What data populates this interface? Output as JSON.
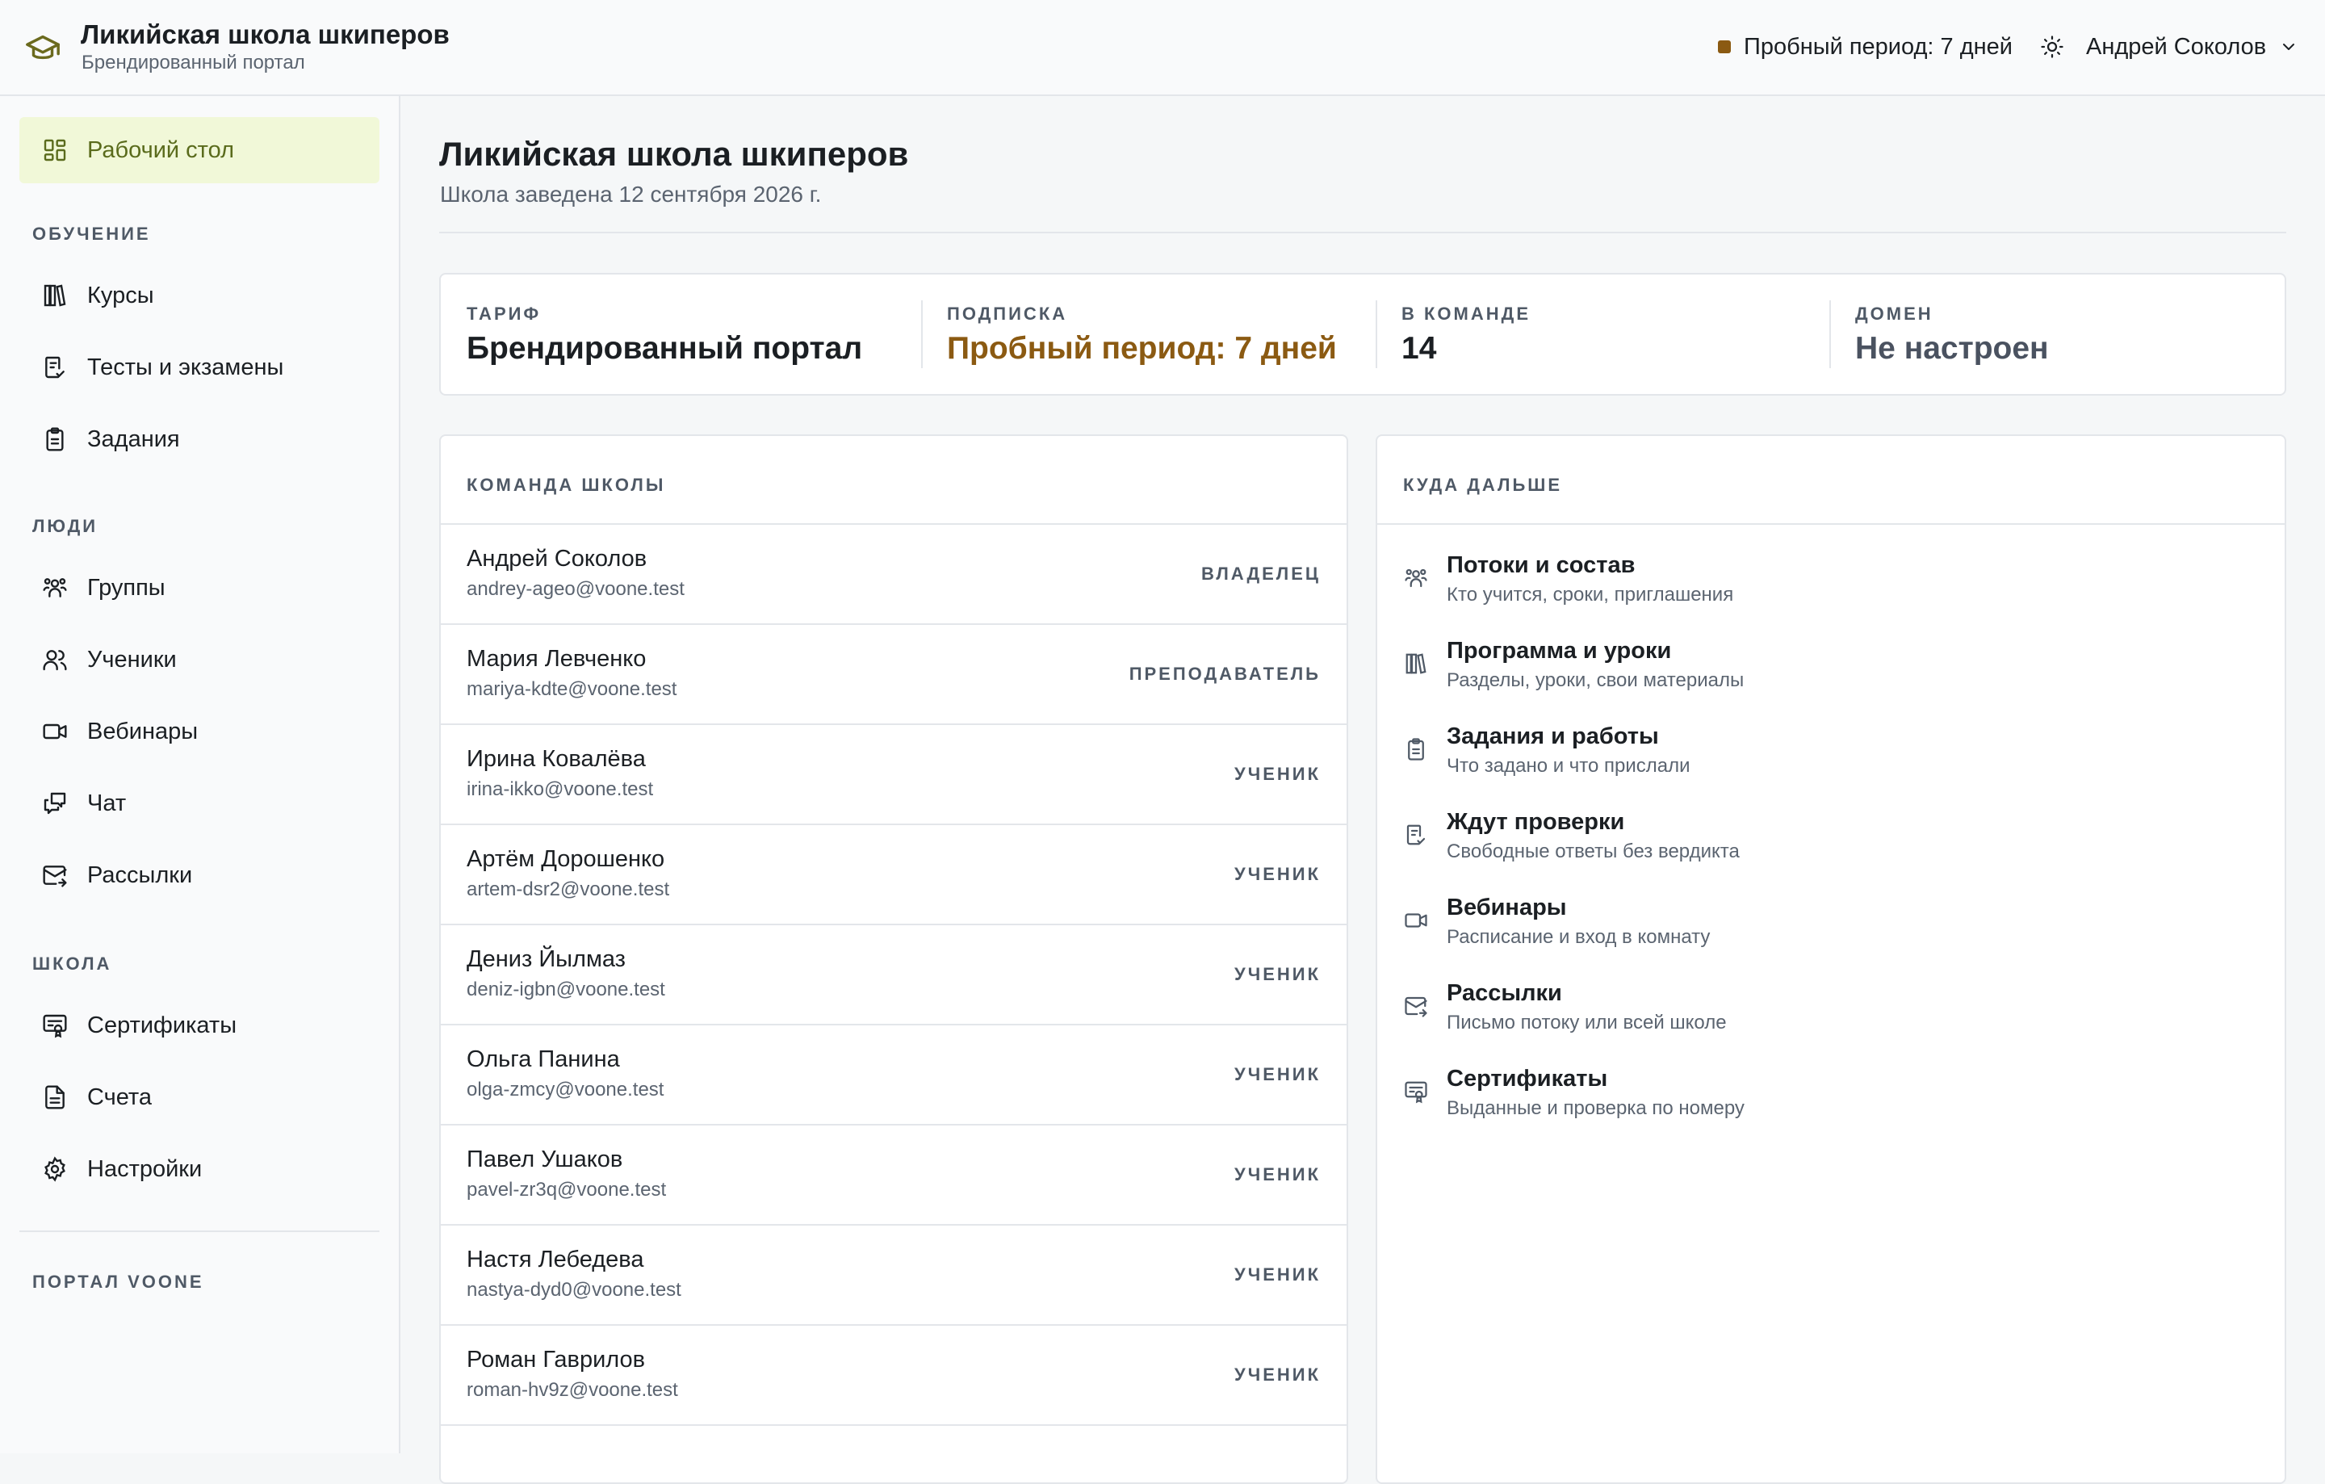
{
  "header": {
    "title": "Ликийская школа шкиперов",
    "subtitle": "Брендированный портал",
    "trial": "Пробный период: 7 дней",
    "user": "Андрей Соколов"
  },
  "sidebar": {
    "home": "Рабочий стол",
    "sections": {
      "learning": "ОБУЧЕНИЕ",
      "people": "ЛЮДИ",
      "school": "ШКОЛА",
      "portal": "ПОРТАЛ VOONE"
    },
    "learning_items": [
      "Курсы",
      "Тесты и экзамены",
      "Задания"
    ],
    "people_items": [
      "Группы",
      "Ученики",
      "Вебинары",
      "Чат",
      "Рассылки"
    ],
    "school_items": [
      "Сертификаты",
      "Счета",
      "Настройки"
    ]
  },
  "page": {
    "title": "Ликийская школа шкиперов",
    "subtitle": "Школа заведена 12 сентября 2026 г."
  },
  "stats": [
    {
      "label": "ТАРИФ",
      "value": "Брендированный портал"
    },
    {
      "label": "ПОДПИСКА",
      "value": "Пробный период: 7 дней"
    },
    {
      "label": "В КОМАНДЕ",
      "value": "14"
    },
    {
      "label": "ДОМЕН",
      "value": "Не настроен"
    }
  ],
  "team": {
    "title": "КОМАНДА ШКОЛЫ",
    "members": [
      {
        "name": "Андрей Соколов",
        "email": "andrey-ageo@voone.test",
        "role": "ВЛАДЕЛЕЦ"
      },
      {
        "name": "Мария Левченко",
        "email": "mariya-kdte@voone.test",
        "role": "ПРЕПОДАВАТЕЛЬ"
      },
      {
        "name": "Ирина Ковалёва",
        "email": "irina-ikko@voone.test",
        "role": "УЧЕНИК"
      },
      {
        "name": "Артём Дорошенко",
        "email": "artem-dsr2@voone.test",
        "role": "УЧЕНИК"
      },
      {
        "name": "Дениз Йылмаз",
        "email": "deniz-igbn@voone.test",
        "role": "УЧЕНИК"
      },
      {
        "name": "Ольга Панина",
        "email": "olga-zmcy@voone.test",
        "role": "УЧЕНИК"
      },
      {
        "name": "Павел Ушаков",
        "email": "pavel-zr3q@voone.test",
        "role": "УЧЕНИК"
      },
      {
        "name": "Настя Лебедева",
        "email": "nastya-dyd0@voone.test",
        "role": "УЧЕНИК"
      },
      {
        "name": "Роман Гаврилов",
        "email": "roman-hv9z@voone.test",
        "role": "УЧЕНИК"
      }
    ]
  },
  "next": {
    "title": "КУДА ДАЛЬШЕ",
    "items": [
      {
        "title": "Потоки и состав",
        "desc": "Кто учится, сроки, приглашения"
      },
      {
        "title": "Программа и уроки",
        "desc": "Разделы, уроки, свои материалы"
      },
      {
        "title": "Задания и работы",
        "desc": "Что задано и что прислали"
      },
      {
        "title": "Ждут проверки",
        "desc": "Свободные ответы без вердикта"
      },
      {
        "title": "Вебинары",
        "desc": "Расписание и вход в комнату"
      },
      {
        "title": "Рассылки",
        "desc": "Письмо потоку или всей школе"
      },
      {
        "title": "Сертификаты",
        "desc": "Выданные и проверка по номеру"
      }
    ]
  },
  "colors": {
    "accent_olive": "#5a6b1c",
    "active_bg": "#f1f8d8",
    "trial_brown": "#8b5a12",
    "muted": "#5b6470"
  }
}
